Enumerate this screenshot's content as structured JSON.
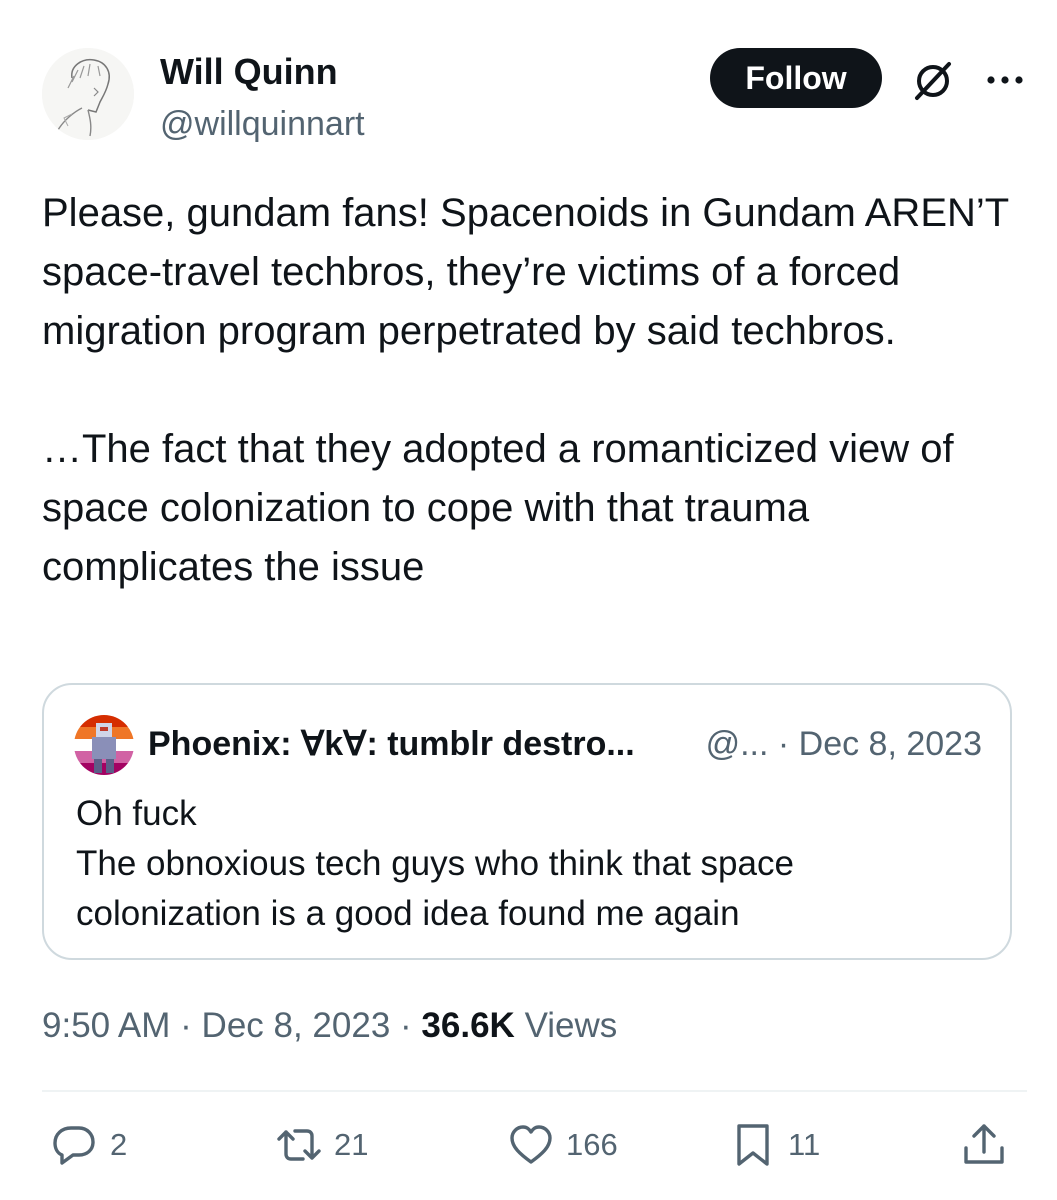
{
  "author": {
    "display_name": "Will Quinn",
    "handle": "@willquinnart"
  },
  "follow_label": "Follow",
  "tweet_text": "Please, gundam fans! Spacenoids in Gundam AREN’T space-travel techbros, they’re victims of a forced migration program perpetrated by said techbros.\n\n…The fact that they adopted a romanticized view of space colonization to cope with that trauma complicates the issue",
  "quote": {
    "display_name": "Phoenix: ∀k∀: tumblr destro...",
    "meta": "@... · Dec 8, 2023",
    "text": "Oh fuck\nThe obnoxious tech guys who think that space colonization is a good idea found me again"
  },
  "meta": {
    "time": "9:50 AM",
    "date": "Dec 8, 2023",
    "views_count": "36.6K",
    "views_label": "Views"
  },
  "actions": {
    "replies": "2",
    "reposts": "21",
    "likes": "166",
    "bookmarks": "11"
  },
  "icons": {
    "grok": "grok-icon",
    "more": "more-icon",
    "reply": "reply-icon",
    "repost": "repost-icon",
    "like": "heart-icon",
    "bookmark": "bookmark-icon",
    "share": "share-icon"
  },
  "colors": {
    "text": "#0f1419",
    "secondary": "#536471",
    "border": "#cfd9de",
    "button_bg": "#0f1419"
  }
}
